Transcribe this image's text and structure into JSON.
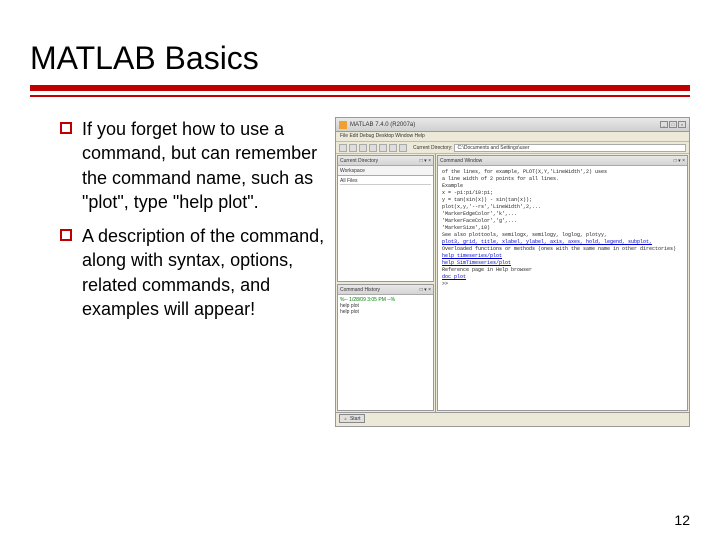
{
  "slide": {
    "title": "MATLAB Basics",
    "bullets": [
      "If you forget how to use a command, but can remember the command name, such as \"plot\", type \"help plot\".",
      "A description of the command, along with syntax, options, related commands, and examples will appear!"
    ],
    "page_number": "12"
  },
  "matlab": {
    "window_title": "MATLAB 7.4.0 (R2007a)",
    "menubar": "File   Edit   Debug   Desktop   Window   Help",
    "toolbar_dir_label": "Current Directory:",
    "toolbar_dir_value": "C:\\Documents and Settings\\user",
    "panels": {
      "current_dir_title": "Current Directory",
      "workspace_tab": "Workspace",
      "current_dir_cols": "All Files",
      "history_title": "Command History",
      "history_lines": [
        "%-- 1/28/09  3:05 PM --%",
        "help plot",
        "help plot"
      ],
      "cmd_title": "Command Window",
      "cmd_lines": [
        "of the lines, for example, PLOT(X,Y,'LineWidth',2) uses",
        "a line width of 2 points for all lines.",
        "",
        "Example",
        "   x = -pi:pi/10:pi;",
        "   y = tan(sin(x)) - sin(tan(x));",
        "   plot(x,y,'--rs','LineWidth',2,...",
        "                  'MarkerEdgeColor','k',...",
        "                  'MarkerFaceColor','g',...",
        "                  'MarkerSize',10)",
        "",
        "See also plottools, semilogx, semilogy, loglog, plotyy,",
        "plot3, grid, title, xlabel, ylabel, axis, axes, hold, legend, subplot,",
        "",
        "Overloaded functions or methods (ones with the same name in other directories)",
        "   help timeseries/plot",
        "   help SimTimeseries/plot",
        "",
        "Reference page in Help browser",
        "   doc plot",
        ">> "
      ]
    },
    "start_button": "Start"
  }
}
